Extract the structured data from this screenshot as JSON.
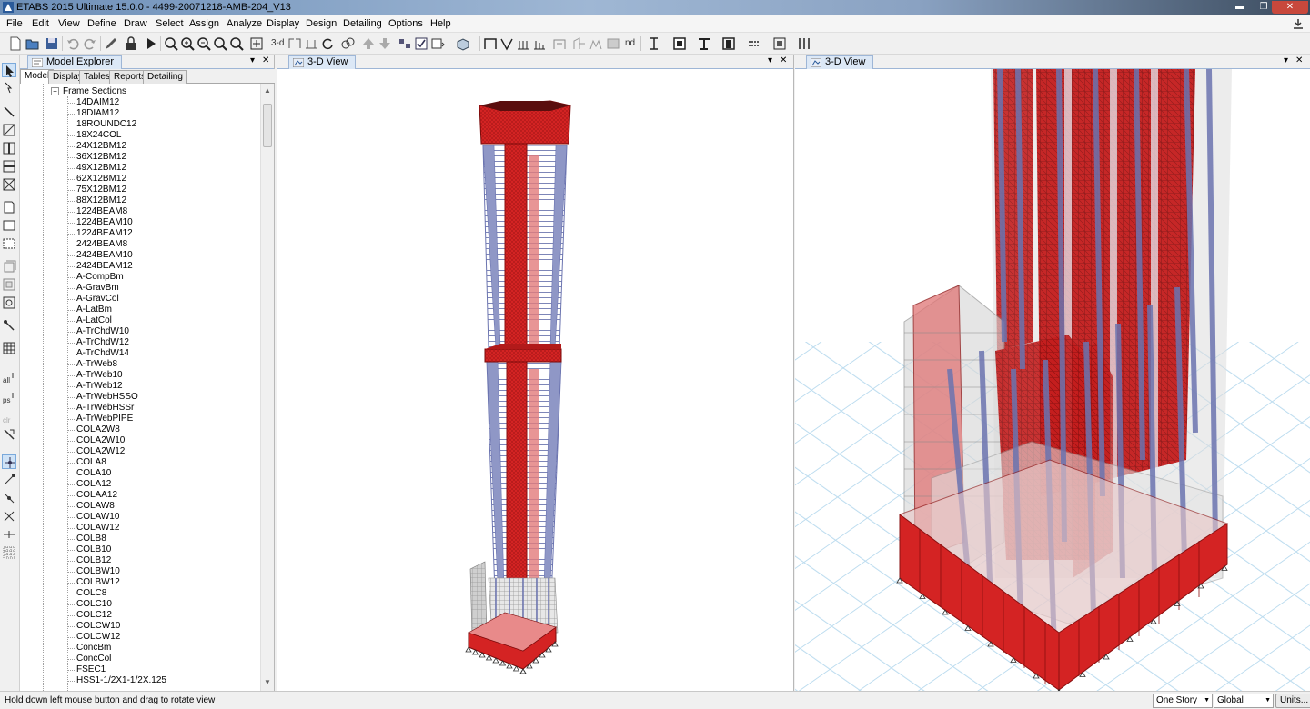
{
  "window": {
    "title": "ETABS 2015 Ultimate 15.0.0 - 4499-20071218-AMB-204_V13",
    "min_glyph": "▬",
    "restore_glyph": "❐",
    "close_glyph": "✕"
  },
  "menu": [
    "File",
    "Edit",
    "View",
    "Define",
    "Draw",
    "Select",
    "Assign",
    "Analyze",
    "Display",
    "Design",
    "Detailing",
    "Options",
    "Help"
  ],
  "toolbar": {
    "label_3d": "3-d",
    "label_nd": "nd"
  },
  "explorer": {
    "title": "Model Explorer",
    "pin_glyph": "▾",
    "close_glyph": "✕",
    "tabs": [
      "Model",
      "Display",
      "Tables",
      "Reports",
      "Detailing"
    ],
    "active_tab": "Model",
    "tree_root": "Frame Sections",
    "tree_toggle": "−",
    "items": [
      "14DAIM12",
      "18DIAM12",
      "18ROUNDC12",
      "18X24COL",
      "24X12BM12",
      "36X12BM12",
      "49X12BM12",
      "62X12BM12",
      "75X12BM12",
      "88X12BM12",
      "1224BEAM8",
      "1224BEAM10",
      "1224BEAM12",
      "2424BEAM8",
      "2424BEAM10",
      "2424BEAM12",
      "A-CompBm",
      "A-GravBm",
      "A-GravCol",
      "A-LatBm",
      "A-LatCol",
      "A-TrChdW10",
      "A-TrChdW12",
      "A-TrChdW14",
      "A-TrWeb8",
      "A-TrWeb10",
      "A-TrWeb12",
      "A-TrWebHSSO",
      "A-TrWebHSSr",
      "A-TrWebPIPE",
      "COLA2W8",
      "COLA2W10",
      "COLA2W12",
      "COLA8",
      "COLA10",
      "COLA12",
      "COLAA12",
      "COLAW8",
      "COLAW10",
      "COLAW12",
      "COLB8",
      "COLB10",
      "COLB12",
      "COLBW10",
      "COLBW12",
      "COLC8",
      "COLC10",
      "COLC12",
      "COLCW10",
      "COLCW12",
      "ConcBm",
      "ConcCol",
      "FSEC1",
      "HSS1-1/2X1-1/2X.125"
    ]
  },
  "views": [
    {
      "title": "3-D View",
      "pin_glyph": "▾",
      "close_glyph": "✕"
    },
    {
      "title": "3-D View",
      "pin_glyph": "▾",
      "close_glyph": "✕"
    }
  ],
  "status": {
    "message": "Hold down left mouse button and drag to rotate view",
    "story_select": "One Story",
    "coord_select": "Global",
    "units_button": "Units..."
  },
  "colors": {
    "wall": "#d42323",
    "frame": "#6b74b0",
    "grid": "#bcdcef",
    "support": "#333333"
  },
  "icons": [
    "app-icon",
    "new-icon",
    "open-icon",
    "save-icon",
    "undo-icon",
    "redo-icon",
    "edit-icon",
    "lock-icon",
    "run-icon",
    "zoom-icon",
    "pan-icon",
    "3d-view-icon",
    "plan-view-icon",
    "rotate-icon",
    "up-icon",
    "down-icon",
    "select-icon",
    "snap-icon"
  ]
}
